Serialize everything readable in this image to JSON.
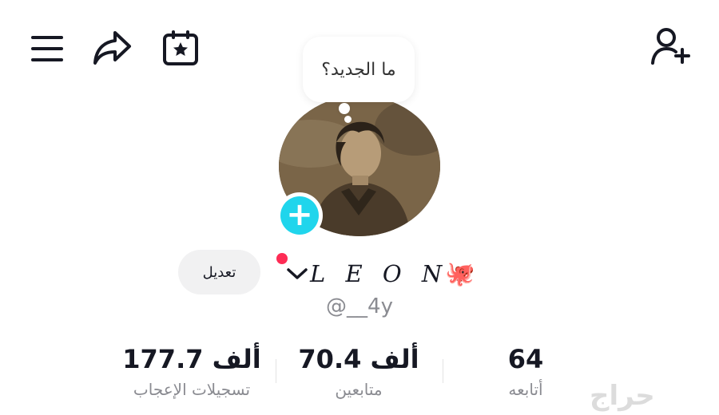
{
  "bubble_text": "ما الجديد؟",
  "profile": {
    "name": "L E O N",
    "emoji": "🐙",
    "username": "@__4y",
    "edit_label": "تعديل"
  },
  "stats": [
    {
      "id": "following",
      "value": "64",
      "label": "أتابعه"
    },
    {
      "id": "followers",
      "value": "70.4 ألف",
      "label": "متابعين"
    },
    {
      "id": "likes",
      "value": "177.7 ألف",
      "label": "تسجيلات الإعجاب"
    }
  ],
  "watermark": "حراج",
  "icons": [
    "menu-icon",
    "share-icon",
    "calendar-star-icon",
    "add-user-icon",
    "chevron-down-icon",
    "plus-icon"
  ],
  "colors": {
    "accent_cyan": "#20d5ec",
    "notification_red": "#fe2c55",
    "text": "#161823",
    "muted": "#8a8b91"
  }
}
